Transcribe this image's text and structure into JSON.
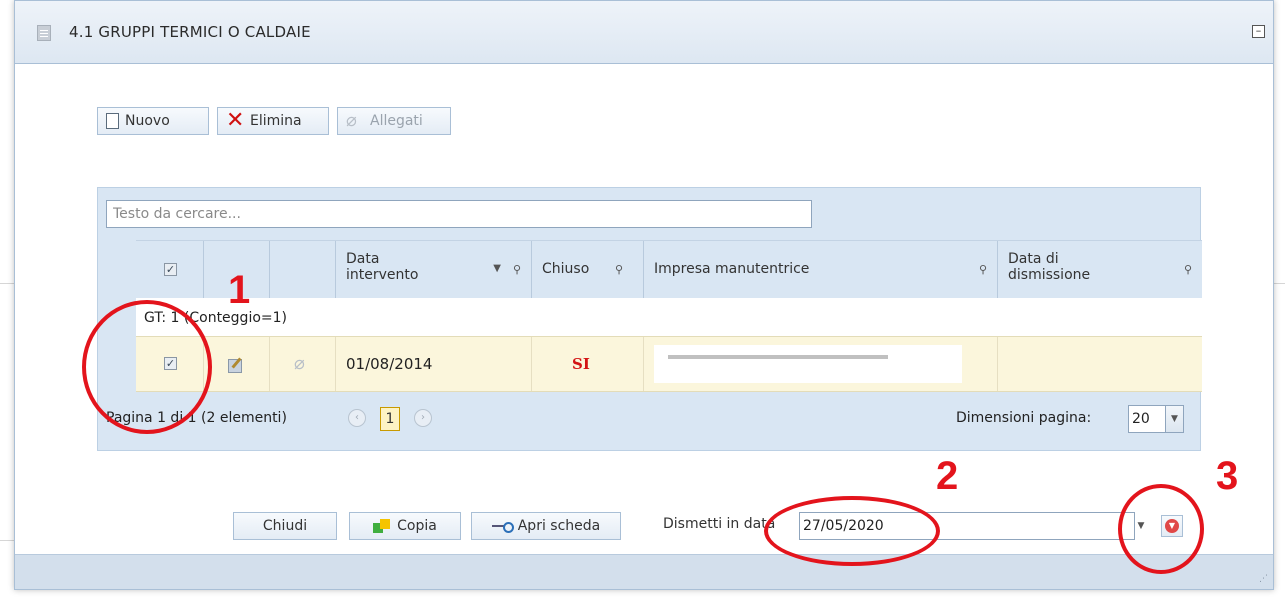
{
  "window": {
    "title": "4.1 GRUPPI TERMICI O CALDAIE",
    "collapse_glyph": "⊟"
  },
  "toolbar": {
    "new_label": "Nuovo",
    "delete_label": "Elimina",
    "attachments_label": "Allegati"
  },
  "search": {
    "placeholder": "Testo da cercare..."
  },
  "grid": {
    "columns": {
      "data_intervento": "Data intervento",
      "chiuso": "Chiuso",
      "impresa": "Impresa manutentrice",
      "data_dismissione": "Data di dismissione"
    },
    "group_label": "GT: 1 (Conteggio=1)",
    "rows": [
      {
        "selected": true,
        "data_intervento": "01/08/2014",
        "chiuso": "SI",
        "impresa": ""
      }
    ],
    "pager": {
      "info": "Pagina 1 di 1 (2 elementi)",
      "current_page": "1",
      "page_size_label": "Dimensioni pagina:",
      "page_size": "20"
    }
  },
  "footer": {
    "close_label": "Chiudi",
    "copy_label": "Copia",
    "open_label": "Apri scheda",
    "dismiss_label": "Dismetti in data",
    "dismiss_date": "27/05/2020"
  },
  "annotations": {
    "one": "1",
    "two": "2",
    "three": "3"
  },
  "colors": {
    "accent": "#d9e6f3",
    "selected_row": "#fbf6dc",
    "annotation": "#e3141c",
    "si_text": "#d31414"
  }
}
